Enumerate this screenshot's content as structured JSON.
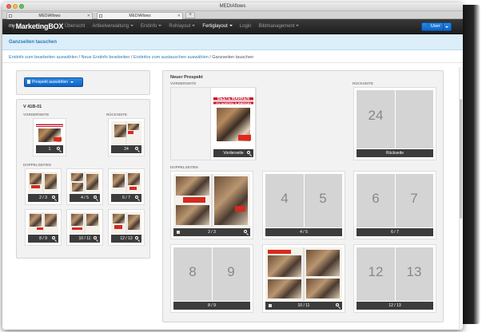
{
  "window": {
    "title": "MEDIAflows"
  },
  "tabs": [
    {
      "label": "MEDIAflows"
    },
    {
      "label": "MEDIAflows"
    }
  ],
  "navbar": {
    "brand_small": "my",
    "brand": "MarketingBOX",
    "items": [
      {
        "label": "Übersicht",
        "dropdown": false
      },
      {
        "label": "Artikelverwaltung",
        "dropdown": true
      },
      {
        "label": "Erstinfo",
        "dropdown": true
      },
      {
        "label": "Rohlayout",
        "dropdown": true
      },
      {
        "label": "Fertiglayout",
        "dropdown": true,
        "active": true
      },
      {
        "label": "Login",
        "dropdown": false
      },
      {
        "label": "Bildmanagement",
        "dropdown": true
      }
    ],
    "user_label": "User"
  },
  "page_header": "Ganzseiten tauschen",
  "breadcrumb": {
    "links": [
      "Erstinfo zum bearbeiten auswählen",
      "Neue Erstinfo bearbeiten",
      "Erstinfos zum austauschen auswählen"
    ],
    "current": "Ganzseiten tauschen",
    "separator": "/"
  },
  "left": {
    "select_button": "Prospekt auswählen",
    "prospekt_title": "V 41B-01",
    "vorderseite_label": "VORDERSEITE",
    "rueckseite_label": "RÜCKSEITE",
    "front_page": "1",
    "back_page": "24",
    "doppelseiten_label": "DOPPELSEITEN",
    "spreads": [
      "2 / 3",
      "4 / 5",
      "6 / 7",
      "8 / 9",
      "10 / 11",
      "12 / 13"
    ]
  },
  "right": {
    "title": "Neuer Prospekt",
    "vorderseite_label": "VORDERSEITE",
    "rueckseite_label": "RÜCKSEITE",
    "doppelseiten_label": "DOPPELSEITEN",
    "front_caption": "Vorderseite",
    "back_caption": "Rückseite",
    "back_page_num": "24",
    "cover_headline_1": "BESTE MARKEN",
    "cover_headline_2": "ZU VORTEILS-PREISEN!",
    "spreads": [
      {
        "label": "2 / 3",
        "filled": true,
        "left": "",
        "right": ""
      },
      {
        "label": "4 / 5",
        "filled": false,
        "left": "4",
        "right": "5"
      },
      {
        "label": "6 / 7",
        "filled": false,
        "left": "6",
        "right": "7"
      },
      {
        "label": "8 / 9",
        "filled": false,
        "left": "8",
        "right": "9"
      },
      {
        "label": "10 / 11",
        "filled": true,
        "left": "",
        "right": ""
      },
      {
        "label": "12 / 13",
        "filled": false,
        "left": "12",
        "right": "13"
      }
    ]
  },
  "colors": {
    "accent": "#0e63c7",
    "header_bg": "#dceef9",
    "promo_red": "#c8172c"
  }
}
